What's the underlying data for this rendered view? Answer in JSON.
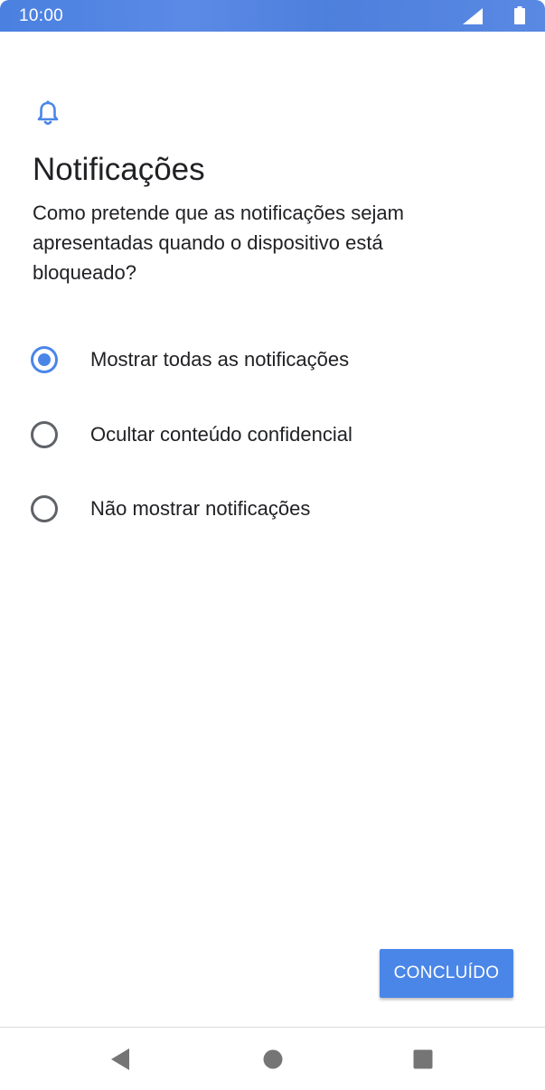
{
  "status_bar": {
    "time": "10:00",
    "signal_icon": "signal-icon",
    "battery_icon": "battery-icon"
  },
  "header": {
    "icon": "bell-icon",
    "title": "Notificações",
    "description": "Como pretende que as notificações sejam apresentadas quando o dispositivo está bloqueado?"
  },
  "options": [
    {
      "label": "Mostrar todas as notificações",
      "selected": true
    },
    {
      "label": "Ocultar conteúdo confidencial",
      "selected": false
    },
    {
      "label": "Não mostrar notificações",
      "selected": false
    }
  ],
  "actions": {
    "done_label": "CONCLUÍDO"
  },
  "navigation": {
    "back_icon": "back-triangle-icon",
    "home_icon": "home-circle-icon",
    "recents_icon": "recents-square-icon"
  },
  "colors": {
    "accent": "#4a86e8",
    "status_bar": "#4a80e0",
    "text": "#202124",
    "radio_unchecked": "#5f6368",
    "nav_icon": "#757575"
  }
}
